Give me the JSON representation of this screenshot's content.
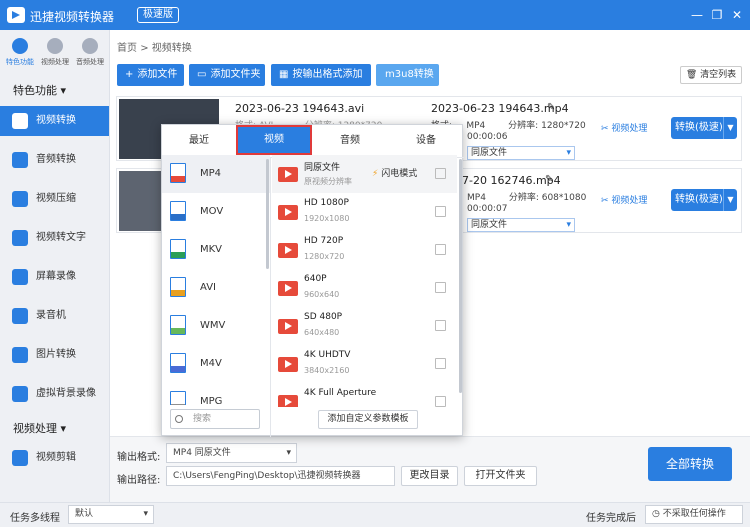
{
  "app": {
    "title": "迅捷视频转换器",
    "edition": "极速版"
  },
  "window_controls": [
    "minimize",
    "restore",
    "close"
  ],
  "sidebar": {
    "top_icons": [
      {
        "label": "特色功能",
        "icon": "star-icon",
        "active": true
      },
      {
        "label": "视频处理",
        "icon": "film-icon",
        "active": false
      },
      {
        "label": "音频处理",
        "icon": "audio-icon",
        "active": false
      }
    ],
    "section1": "特色功能",
    "items": [
      {
        "label": "视频转换",
        "icon": "video-convert-icon",
        "active": true
      },
      {
        "label": "音频转换",
        "icon": "audio-convert-icon"
      },
      {
        "label": "视频压缩",
        "icon": "compress-icon"
      },
      {
        "label": "视频转文字",
        "icon": "video-to-text-icon"
      },
      {
        "label": "屏幕录像",
        "icon": "screen-record-icon"
      },
      {
        "label": "录音机",
        "icon": "recorder-icon"
      },
      {
        "label": "图片转换",
        "icon": "image-convert-icon"
      },
      {
        "label": "虚拟背景录像",
        "icon": "virtual-bg-icon"
      }
    ],
    "section2": "视频处理",
    "items2": [
      {
        "label": "视频剪辑",
        "icon": "video-edit-icon"
      }
    ]
  },
  "breadcrumb": {
    "home": "首页",
    "sep": ">",
    "current": "视频转换"
  },
  "toolbar": {
    "add_file": "添加文件",
    "add_folder": "添加文件夹",
    "add_by_format": "按输出格式添加",
    "m3u8": "m3u8转换",
    "clear_list": "清空列表"
  },
  "files": [
    {
      "src_name": "2023-06-23 194643.avi",
      "src_format": "格式:",
      "src_format_val": "AVI",
      "src_res_label": "分辨率:",
      "src_res": "1280*720",
      "out_name": "2023-06-23 194643.mp4",
      "out_format_label": "格式:",
      "out_format": "MP4",
      "out_res_label": "分辨率:",
      "out_res": "1280*720",
      "out_duration": "00:00:06",
      "quality": "同原文件",
      "process_label": "视频处理",
      "convert_label": "转换(极速)"
    },
    {
      "out_name": "2023-07-20 162746.mp4",
      "out_name_visible": "7-20 162746.mp4",
      "out_format_label": "格式:",
      "out_format": "MP4",
      "out_res_label": "分辨率:",
      "out_res": "608*1080",
      "out_duration": "00:00:07",
      "quality": "同原文件",
      "process_label": "视频处理",
      "convert_label": "转换(极速)"
    }
  ],
  "popup": {
    "tabs": [
      "最近",
      "视频",
      "音频",
      "设备"
    ],
    "active_tab": "视频",
    "formats": [
      {
        "name": "MP4",
        "color": "#e64a3a",
        "active": true
      },
      {
        "name": "MOV",
        "color": "#2a6fc8"
      },
      {
        "name": "MKV",
        "color": "#2a9e58"
      },
      {
        "name": "AVI",
        "color": "#e8a020"
      },
      {
        "name": "WMV",
        "color": "#67b85a"
      },
      {
        "name": "M4V",
        "color": "#4a6bd6"
      },
      {
        "name": "MPG",
        "color": "#8f8f8f"
      }
    ],
    "presets": [
      {
        "name": "同原文件",
        "res": "原视频分辨率",
        "badge": "闪电模式"
      },
      {
        "name": "HD 1080P",
        "res": "1920x1080"
      },
      {
        "name": "HD 720P",
        "res": "1280x720"
      },
      {
        "name": "640P",
        "res": "960x640"
      },
      {
        "name": "SD 480P",
        "res": "640x480"
      },
      {
        "name": "4K UHDTV",
        "res": "3840x2160"
      },
      {
        "name": "4K Full Aperture",
        "res": ""
      }
    ],
    "search_placeholder": "搜索",
    "add_preset": "添加自定义参数模板"
  },
  "output": {
    "format_label": "输出格式:",
    "format_value": "MP4  同原文件",
    "path_label": "输出路径:",
    "path_value": "C:\\Users\\FengPing\\Desktop\\迅捷视频转换器",
    "change_dir": "更改目录",
    "open_folder": "打开文件夹",
    "convert_all": "全部转换"
  },
  "status": {
    "multithread_label": "任务多线程",
    "multithread_value": "默认",
    "after_done_label": "任务完成后",
    "after_done_value": "不采取任何操作"
  },
  "colors": {
    "accent": "#2a7ee0",
    "active_tab_border": "#e03a3a",
    "preset_icon": "#e64a3a"
  }
}
